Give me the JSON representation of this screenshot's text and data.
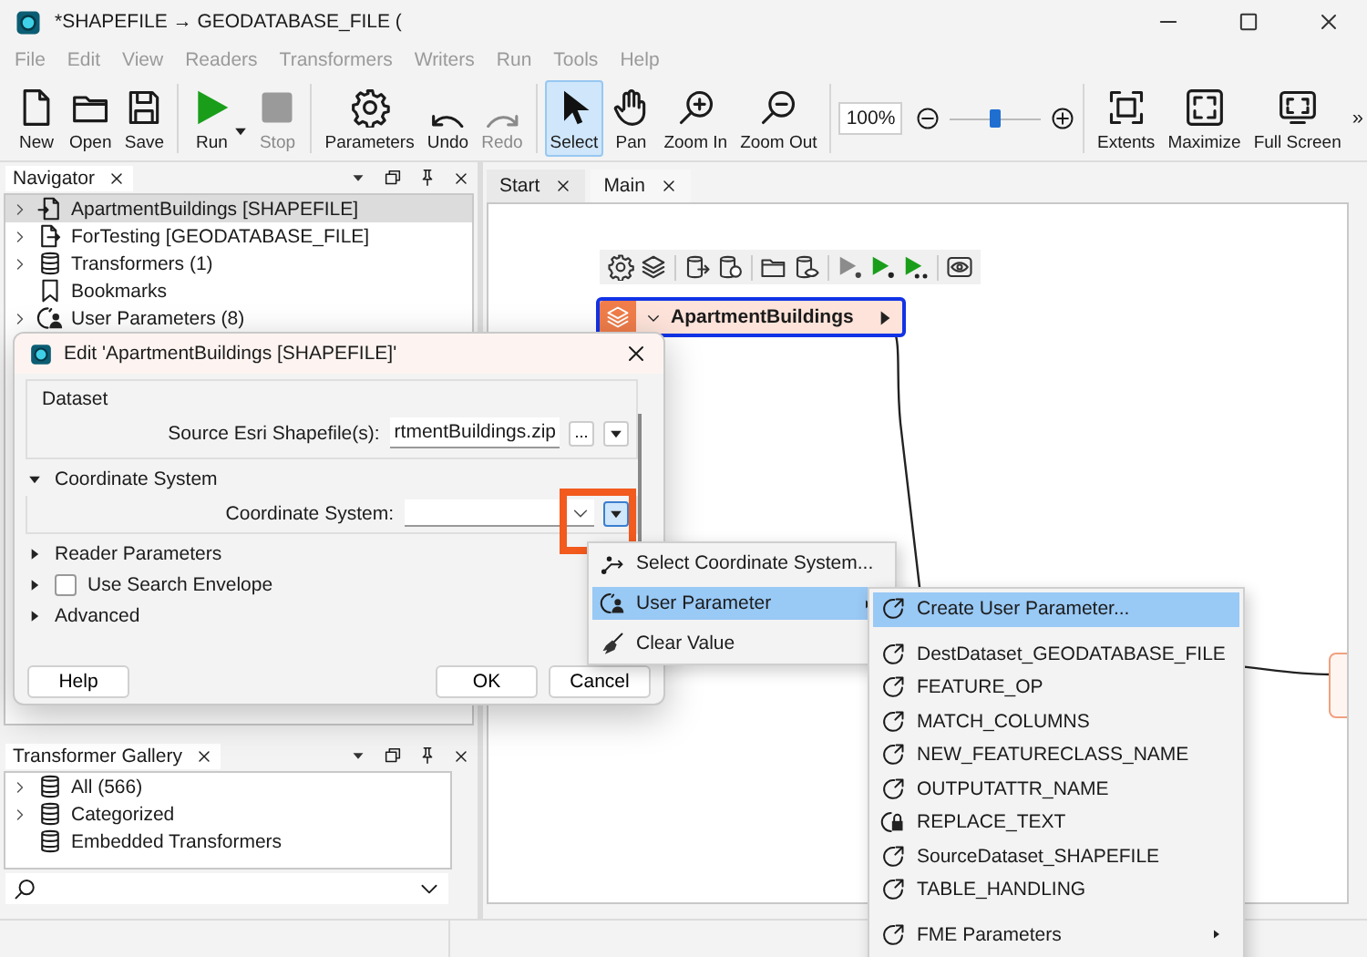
{
  "window": {
    "title": "*SHAPEFILE → GEODATABASE_FILE ("
  },
  "menu": [
    {
      "label": "File",
      "disabled": true
    },
    {
      "label": "Edit",
      "disabled": true
    },
    {
      "label": "View",
      "disabled": true
    },
    {
      "label": "Readers",
      "disabled": true
    },
    {
      "label": "Transformers",
      "disabled": true
    },
    {
      "label": "Writers",
      "disabled": true
    },
    {
      "label": "Run",
      "disabled": true
    },
    {
      "label": "Tools",
      "disabled": true
    },
    {
      "label": "Help",
      "disabled": true
    }
  ],
  "toolbar": {
    "groups": [
      [
        {
          "label": "New",
          "disabled": false,
          "selected": false
        },
        {
          "label": "Open",
          "disabled": false,
          "selected": false
        },
        {
          "label": "Save",
          "disabled": false,
          "selected": false
        }
      ],
      [
        {
          "label": "Run",
          "disabled": false,
          "selected": false,
          "dropdown": true
        },
        {
          "label": "Stop",
          "disabled": true,
          "selected": false
        }
      ],
      [
        {
          "label": "Parameters",
          "disabled": false,
          "selected": false
        },
        {
          "label": "Undo",
          "disabled": false,
          "selected": false
        },
        {
          "label": "Redo",
          "disabled": true,
          "selected": false
        }
      ],
      [
        {
          "label": "Select",
          "disabled": false,
          "selected": true
        },
        {
          "label": "Pan",
          "disabled": false,
          "selected": false
        },
        {
          "label": "Zoom In",
          "disabled": false,
          "selected": false
        },
        {
          "label": "Zoom Out",
          "disabled": false,
          "selected": false
        }
      ]
    ],
    "zoom": {
      "value": "100%",
      "level": 0.5
    },
    "right": [
      {
        "label": "Extents",
        "disabled": false,
        "selected": false
      },
      {
        "label": "Maximize",
        "disabled": false,
        "selected": false
      },
      {
        "label": "Full Screen",
        "disabled": false,
        "selected": false
      }
    ],
    "overflow": "»"
  },
  "navigator": {
    "title": "Navigator",
    "items": [
      {
        "label": "ApartmentBuildings [SHAPEFILE]",
        "expandable": true,
        "selected": true
      },
      {
        "label": "ForTesting [GEODATABASE_FILE]",
        "expandable": true,
        "selected": false
      },
      {
        "label": "Transformers (1)",
        "expandable": true,
        "selected": false
      },
      {
        "label": "Bookmarks",
        "expandable": false,
        "selected": false
      },
      {
        "label": "User Parameters (8)",
        "expandable": true,
        "selected": false
      }
    ]
  },
  "gallery": {
    "title": "Transformer Gallery",
    "items": [
      {
        "label": "All (566)",
        "expandable": true
      },
      {
        "label": "Categorized",
        "expandable": true
      },
      {
        "label": "Embedded Transformers",
        "expandable": false
      }
    ]
  },
  "canvas": {
    "tabs": [
      {
        "label": "Start",
        "selected": false
      },
      {
        "label": "Main",
        "selected": true
      }
    ],
    "node": {
      "label": "ApartmentBuildings",
      "selected": true
    }
  },
  "dialog": {
    "title": "Edit 'ApartmentBuildings [SHAPEFILE]'",
    "dataset": {
      "title": "Dataset",
      "label": "Source Esri Shapefile(s):",
      "value": "rtmentBuildings.zip",
      "browse": "..."
    },
    "coordinate_system": {
      "title": "Coordinate System",
      "expanded": true,
      "label": "Coordinate System:"
    },
    "sections": [
      {
        "kind": "expander",
        "label": "Reader Parameters",
        "expanded": false
      },
      {
        "kind": "checkbox",
        "label": "Use Search Envelope",
        "expanded": false,
        "checked": false
      },
      {
        "kind": "expander",
        "label": "Advanced",
        "expanded": false
      }
    ],
    "buttons": [
      "Help",
      "OK",
      "Cancel"
    ]
  },
  "context_menu": {
    "items": [
      {
        "label": "Select Coordinate System...",
        "submenu": false,
        "selected": false
      },
      {
        "label": "User Parameter",
        "submenu": true,
        "selected": true
      },
      {
        "label": "Clear Value",
        "submenu": false,
        "selected": false
      }
    ]
  },
  "submenu": {
    "items": [
      {
        "label": "Create User Parameter...",
        "kind": "parameter",
        "submenu": false,
        "selected": true
      },
      {
        "label": "DestDataset_GEODATABASE_FILE",
        "kind": "parameter",
        "submenu": false,
        "selected": false,
        "separator_before": true
      },
      {
        "label": "FEATURE_OP",
        "kind": "parameter",
        "submenu": false,
        "selected": false
      },
      {
        "label": "MATCH_COLUMNS",
        "kind": "parameter",
        "submenu": false,
        "selected": false
      },
      {
        "label": "NEW_FEATURECLASS_NAME",
        "kind": "parameter",
        "submenu": false,
        "selected": false
      },
      {
        "label": "OUTPUTATTR_NAME",
        "kind": "parameter",
        "submenu": false,
        "selected": false
      },
      {
        "label": "REPLACE_TEXT",
        "kind": "locked",
        "submenu": false,
        "selected": false
      },
      {
        "label": "SourceDataset_SHAPEFILE",
        "kind": "parameter",
        "submenu": false,
        "selected": false
      },
      {
        "label": "TABLE_HANDLING",
        "kind": "parameter",
        "submenu": false,
        "selected": false
      },
      {
        "label": "FME Parameters",
        "kind": "parameter",
        "submenu": true,
        "selected": false,
        "separator_before": true
      }
    ]
  }
}
